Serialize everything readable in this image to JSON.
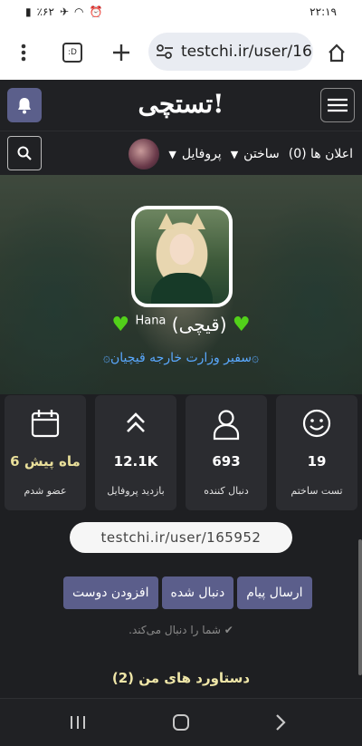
{
  "status_bar": {
    "time": "۲۲:۱۹",
    "battery": "٪۶۲"
  },
  "browser": {
    "url": "testchi.ir/user/16",
    "tab_label": ":D"
  },
  "site": {
    "logo": "تستچی!"
  },
  "nav": {
    "items": [
      {
        "label": "پروفایل"
      },
      {
        "label": "ساختن"
      },
      {
        "label": "اعلان ها (0)"
      }
    ]
  },
  "profile": {
    "name": "(قیچی)",
    "name_small": "Hana",
    "subtitle": "۞سفیر وزارت خارجه قیچیان۞"
  },
  "stats": [
    {
      "icon": "smiley-icon",
      "value": "19",
      "label": "تست ساختم"
    },
    {
      "icon": "user-icon",
      "value": "693",
      "label": "دنبال کننده"
    },
    {
      "icon": "double-chevron-up-icon",
      "value": "12.1K",
      "label": "بازدید پروفایل"
    },
    {
      "icon": "calendar-icon",
      "value": "6 ماه پیش",
      "label": "عضو شدم"
    }
  ],
  "profile_link": "testchi.ir/user/165952",
  "actions": [
    {
      "label": "ارسال پیام"
    },
    {
      "label": "دنبال شده"
    },
    {
      "label": "افزودن دوست"
    }
  ],
  "follows_you": "شما را دنبال می‌کند.",
  "achievements_title": "دستاورد های من (2)",
  "colors": {
    "accent": "#5b5e8b",
    "heart": "#52d01a",
    "link": "#5aa9ff",
    "gold": "#e9df9a"
  }
}
